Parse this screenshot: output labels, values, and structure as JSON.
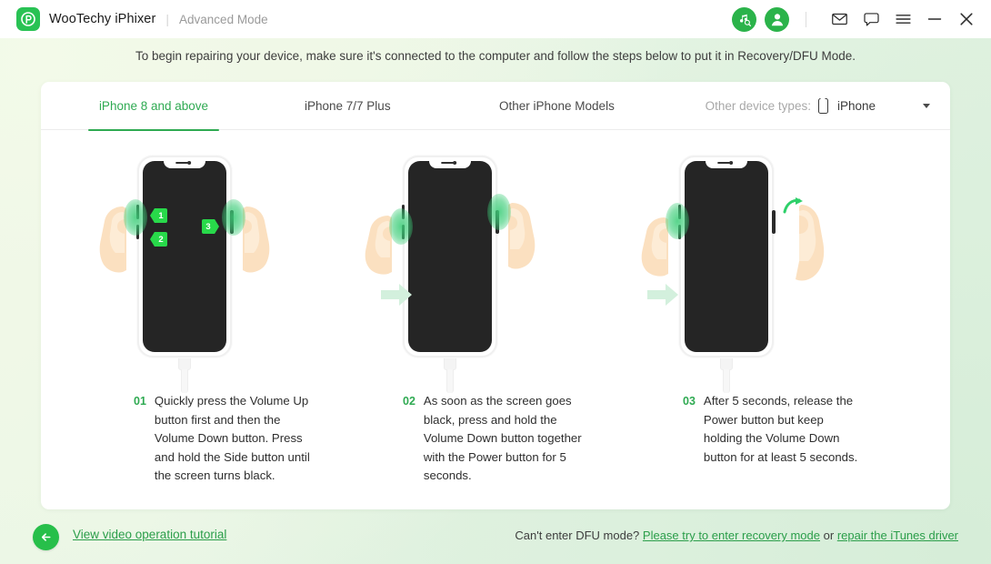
{
  "titlebar": {
    "logo_icon": "wootechy-logo-icon",
    "app_name": "WooTechy iPhixer",
    "separator": "|",
    "mode": "Advanced Mode",
    "icons": [
      {
        "name": "music-search-icon",
        "glyph": "music-note-magnifier"
      },
      {
        "name": "account-avatar-icon",
        "glyph": "person"
      },
      {
        "name": "mail-icon",
        "glyph": "envelope"
      },
      {
        "name": "feedback-icon",
        "glyph": "speech-bubble"
      },
      {
        "name": "menu-icon",
        "glyph": "hamburger"
      },
      {
        "name": "minimize-icon",
        "glyph": "minus"
      },
      {
        "name": "close-icon",
        "glyph": "cross"
      }
    ]
  },
  "banner": {
    "text": "To begin repairing your device, make sure it's connected to the computer and follow the steps below to put it in Recovery/DFU Mode."
  },
  "tabs": [
    {
      "label": "iPhone 8 and above",
      "active": true
    },
    {
      "label": "iPhone 7/7 Plus",
      "active": false
    },
    {
      "label": "Other iPhone Models",
      "active": false
    }
  ],
  "device_type": {
    "label": "Other device types:",
    "icon": "phone-icon",
    "value": "iPhone",
    "caret": "chevron-down-icon"
  },
  "steps": [
    {
      "number": "01",
      "text": "Quickly press the Volume Up button first and then the Volume Down button. Press and hold the Side button until the screen turns black.",
      "badges": [
        "1",
        "2",
        "3"
      ]
    },
    {
      "number": "02",
      "text": "As soon as the screen goes black, press and hold the Volume Down button together with the Power button for 5 seconds.",
      "badges": []
    },
    {
      "number": "03",
      "text": "After 5 seconds, release the Power button but keep holding the Volume Down button for at least 5 seconds.",
      "badges": []
    }
  ],
  "footer": {
    "back_button": "back-arrow-icon",
    "tutorial_link": "View video operation tutorial",
    "help_prefix": "Can't enter DFU mode?",
    "recovery_link": "Please try to enter recovery mode",
    "conjunction": "or",
    "itunes_link": "repair the iTunes driver"
  },
  "colors": {
    "brand_green": "#2faa52",
    "accent_green": "#27bf4a",
    "badge_green": "#28d94a",
    "background_green": "#e9f6e6",
    "card_white": "#ffffff"
  }
}
